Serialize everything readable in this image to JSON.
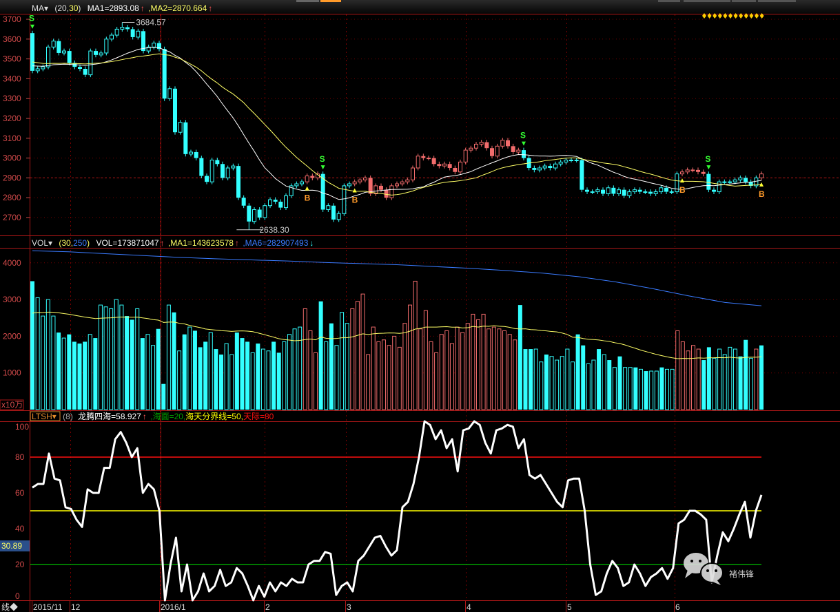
{
  "colors": {
    "up_regime": "#f26c6c",
    "down_regime": "#33ffff",
    "ma1": "#ffffff",
    "ma2": "#ffff66",
    "vol_ma250": "#3a7bff",
    "ltsh_line": "#ffffff",
    "sea": "#00a000",
    "mid": "#ffff00",
    "sky": "#ff1010",
    "grid": "#7a0000"
  },
  "price_panel": {
    "indicator_name": "MA▾",
    "params_open": "(20,",
    "param2": "30",
    "params_close": ")",
    "ma1_label": "MA1=2893.08",
    "ma1_arrow": "↑",
    "ma2_label": ",MA2=2870.664",
    "ma2_arrow": "↑",
    "high_label": "3684.57",
    "low_label": "2638.30",
    "signal_s": "S",
    "signal_b": "B"
  },
  "volume_panel": {
    "indicator_name": "VOL▾",
    "params_open": "(30,",
    "param2": "250",
    "params_close": ")",
    "vol_label": "VOL=173871047",
    "vol_arrow": "↑",
    "ma1_label": ",MA1=143623578",
    "ma1_arrow": "↑",
    "ma6_label": ",MA6=282907493",
    "ma6_arrow": "↓",
    "unit_label": "x10万"
  },
  "ltsh_panel": {
    "indicator_name": "LTSH▾",
    "param": "(8)",
    "value_label": "龙腾四海=58.927",
    "value_arrow": "↑",
    "sea_label": ",海面=20,",
    "mid_label": "海天分界线=50,",
    "sky_label": "天际=80",
    "cursor_value": "30.89"
  },
  "x_axis": {
    "corner_label": "线◆",
    "labels": [
      "2015/11",
      "12",
      "2016/1",
      "2",
      "3",
      "4",
      "5",
      "6"
    ]
  },
  "watermark": {
    "name": "褚伟锋"
  },
  "chart_data": [
    {
      "type": "candlestick",
      "title": "MA (20,30)",
      "ylim": [
        2600,
        3720
      ],
      "yticks": [
        3700,
        3600,
        3500,
        3400,
        3300,
        3200,
        3100,
        3000,
        2900,
        2800,
        2700
      ],
      "first_open": 3630,
      "high": 3684.57,
      "high_index": 17,
      "low": 2638.3,
      "low_index": 41,
      "closes": [
        3440,
        3450,
        3460,
        3560,
        3590,
        3530,
        3540,
        3480,
        3460,
        3450,
        3420,
        3540,
        3520,
        3530,
        3600,
        3620,
        3650,
        3660,
        3650,
        3610,
        3640,
        3540,
        3560,
        3580,
        3550,
        3300,
        3350,
        3130,
        3180,
        3020,
        3030,
        3000,
        2910,
        2880,
        2990,
        2970,
        2900,
        2950,
        2960,
        2800,
        2760,
        2680,
        2740,
        2700,
        2760,
        2790,
        2780,
        2750,
        2810,
        2860,
        2870,
        2880,
        2910,
        2900,
        2920,
        2740,
        2760,
        2690,
        2720,
        2860,
        2870,
        2880,
        2890,
        2900,
        2820,
        2860,
        2840,
        2800,
        2860,
        2870,
        2880,
        2890,
        2950,
        3010,
        3000,
        3000,
        2970,
        2960,
        2970,
        2950,
        2930,
        2980,
        3040,
        3050,
        3070,
        3080,
        3050,
        3010,
        3060,
        3090,
        3060,
        3030,
        3040,
        3000,
        2950,
        2940,
        2950,
        2960,
        2950,
        2970,
        2980,
        2990,
        2990,
        2990,
        2840,
        2830,
        2830,
        2840,
        2820,
        2850,
        2820,
        2840,
        2810,
        2830,
        2840,
        2830,
        2830,
        2820,
        2830,
        2850,
        2830,
        2830,
        2920,
        2930,
        2940,
        2940,
        2930,
        2920,
        2840,
        2830,
        2880,
        2880,
        2880,
        2890,
        2900,
        2880,
        2860,
        2900,
        2920
      ],
      "red_ranges": [
        [
          52,
          54
        ],
        [
          61,
          92
        ],
        [
          123,
          127
        ],
        [
          138,
          138
        ]
      ],
      "signals": [
        {
          "i": 0,
          "type": "S"
        },
        {
          "i": 52,
          "type": "B"
        },
        {
          "i": 55,
          "type": "S"
        },
        {
          "i": 61,
          "type": "B"
        },
        {
          "i": 93,
          "type": "S"
        },
        {
          "i": 123,
          "type": "B"
        },
        {
          "i": 128,
          "type": "S"
        },
        {
          "i": 138,
          "type": "B"
        }
      ],
      "ma_periods": [
        20,
        30
      ]
    },
    {
      "type": "bar",
      "title": "VOL (30,250)",
      "unit": "x10万",
      "ylim": [
        0,
        4400
      ],
      "yticks": [
        4000,
        3000,
        2000,
        1000
      ],
      "values": [
        3500,
        3050,
        2550,
        3000,
        2550,
        2100,
        1950,
        2050,
        1850,
        1800,
        1850,
        2050,
        1950,
        2850,
        2800,
        2750,
        3000,
        2850,
        2550,
        2450,
        2750,
        1950,
        2050,
        1750,
        2200,
        700,
        2850,
        2650,
        1600,
        2050,
        2250,
        2150,
        1700,
        1850,
        2100,
        1650,
        1500,
        1800,
        1500,
        2100,
        1950,
        1850,
        1550,
        1800,
        1650,
        1600,
        1850,
        1550,
        1850,
        2050,
        2200,
        2250,
        2750,
        2150,
        1550,
        2950,
        1850,
        2350,
        1750,
        2650,
        2350,
        2750,
        2950,
        3150,
        1500,
        2250,
        1850,
        1900,
        1750,
        2000,
        1700,
        2350,
        2850,
        3500,
        2200,
        2700,
        1850,
        1550,
        2050,
        2150,
        1800,
        2250,
        2100,
        2350,
        2600,
        2450,
        2600,
        2200,
        2250,
        2200,
        2150,
        2050,
        1900,
        2850,
        1650,
        1650,
        1650,
        1300,
        1500,
        1450,
        1350,
        1450,
        1650,
        1300,
        2050,
        1750,
        1250,
        1350,
        1650,
        1500,
        1350,
        1150,
        1450,
        1150,
        1150,
        1150,
        1100,
        1050,
        1050,
        1050,
        1150,
        1100,
        1100,
        2150,
        1850,
        1600,
        1750,
        1650,
        1350,
        1700,
        1400,
        1650,
        1500,
        1700,
        1650,
        1450,
        1900,
        1400,
        1650,
        1750
      ],
      "ma_period": 30,
      "ma250_values": [
        4330,
        4300,
        4250,
        4200,
        4150,
        4110,
        4080,
        4050,
        4010,
        3980,
        3950,
        3900,
        3850,
        3790,
        3720,
        3620,
        3480,
        3300,
        3100,
        2920,
        2830
      ]
    },
    {
      "type": "line",
      "title": "LTSH (8)",
      "ylim": [
        0,
        100
      ],
      "yticks": [
        100,
        80,
        60,
        40,
        20,
        0
      ],
      "hlines": [
        {
          "value": 80,
          "name": "天际"
        },
        {
          "value": 50,
          "name": "海天分界线"
        },
        {
          "value": 20,
          "name": "海面"
        }
      ],
      "values": [
        63,
        65,
        65,
        82,
        68,
        67,
        52,
        51,
        45,
        41,
        62,
        60,
        60,
        74,
        74,
        90,
        94,
        88,
        80,
        85,
        60,
        65,
        62,
        50,
        0,
        20,
        35,
        5,
        20,
        0,
        5,
        15,
        5,
        8,
        17,
        8,
        10,
        18,
        15,
        8,
        0,
        8,
        2,
        10,
        5,
        10,
        8,
        12,
        10,
        10,
        20,
        22,
        22,
        27,
        26,
        3,
        8,
        10,
        5,
        22,
        25,
        30,
        35,
        36,
        30,
        25,
        28,
        52,
        55,
        65,
        80,
        100,
        98,
        90,
        95,
        85,
        90,
        72,
        95,
        96,
        100,
        98,
        88,
        82,
        95,
        96,
        98,
        97,
        85,
        90,
        70,
        68,
        70,
        65,
        60,
        55,
        52,
        67,
        68,
        68,
        50,
        20,
        3,
        5,
        15,
        22,
        18,
        8,
        10,
        20,
        15,
        8,
        13,
        15,
        18,
        12,
        18,
        43,
        45,
        50,
        50,
        48,
        45,
        10,
        25,
        38,
        33,
        40,
        48,
        55,
        35,
        50,
        58.9
      ]
    }
  ]
}
